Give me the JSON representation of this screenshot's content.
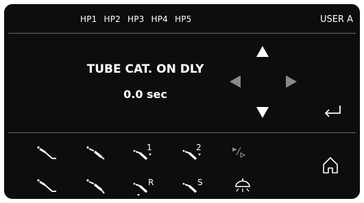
{
  "header": {
    "hp_tabs": [
      "HP1",
      "HP2",
      "HP3",
      "HP4",
      "HP5"
    ],
    "user_label": "USER A"
  },
  "main": {
    "setting_name": "TUBE CAT. ON DLY",
    "setting_value": "0.0 sec"
  },
  "nav": {
    "up_icon": "triangle-up-icon",
    "down_icon": "triangle-down-icon",
    "left_icon": "triangle-left-icon",
    "right_icon": "triangle-right-icon",
    "enter_icon": "enter-return-icon"
  },
  "instrument_row1": {
    "labels": [
      "",
      "",
      "1",
      "2",
      ""
    ]
  },
  "instrument_row2": {
    "labels": [
      "",
      "",
      "R",
      "S",
      ""
    ]
  },
  "colors": {
    "background": "#0d0d0d",
    "text": "#ffffff",
    "disabled": "#8a8a8a",
    "divider": "#6b6b6b"
  }
}
